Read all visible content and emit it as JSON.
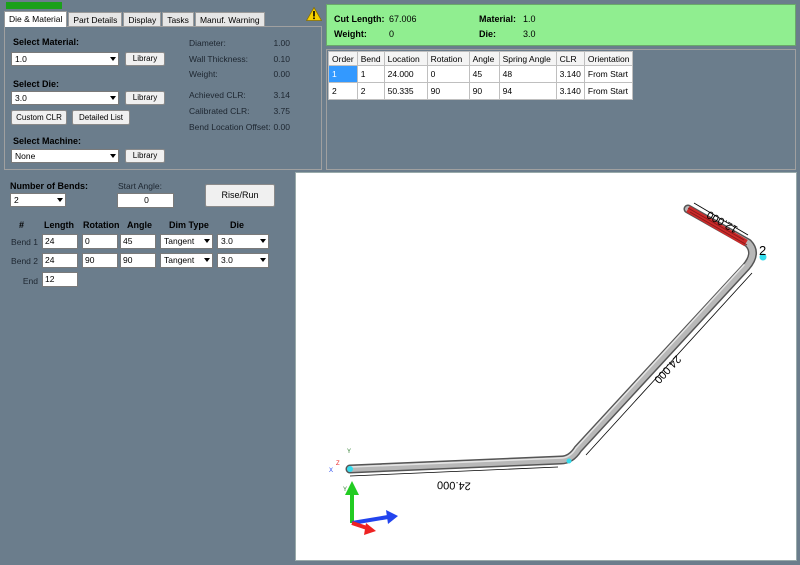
{
  "tabs": [
    "Die & Material",
    "Part Details",
    "Display",
    "Tasks",
    "Manuf. Warning"
  ],
  "die_material": {
    "select_material_label": "Select Material:",
    "material_value": "1.0",
    "select_die_label": "Select Die:",
    "die_value": "3.0",
    "select_machine_label": "Select Machine:",
    "machine_value": "None",
    "library_label": "Library",
    "custom_clr_label": "Custom CLR",
    "detailed_list_label": "Detailed List",
    "props": [
      {
        "label": "Diameter:",
        "value": "1.00"
      },
      {
        "label": "Wall Thickness:",
        "value": "0.10"
      },
      {
        "label": "Weight:",
        "value": "0.00"
      },
      {
        "label": "Achieved CLR:",
        "value": "3.14"
      },
      {
        "label": "Calibrated CLR:",
        "value": "3.75"
      },
      {
        "label": "Bend Location Offset:",
        "value": "0.00"
      }
    ]
  },
  "summary": {
    "cut_length_label": "Cut Length:",
    "cut_length": "67.006",
    "weight_label": "Weight:",
    "weight": "0",
    "material_label": "Material:",
    "material": "1.0",
    "die_label": "Die:",
    "die": "3.0"
  },
  "bend_table": {
    "columns": [
      "Order",
      "Bend",
      "Location",
      "Rotation",
      "Angle",
      "Spring Angle",
      "CLR",
      "Orientation"
    ],
    "rows": [
      [
        "1",
        "1",
        "24.000",
        "0",
        "45",
        "48",
        "3.140",
        "From Start"
      ],
      [
        "2",
        "2",
        "50.335",
        "90",
        "90",
        "94",
        "3.140",
        "From Start"
      ]
    ]
  },
  "editor": {
    "num_bends_label": "Number of Bends:",
    "num_bends": "2",
    "start_angle_label": "Start Angle:",
    "start_angle": "0",
    "rise_run_label": "Rise/Run",
    "columns": [
      "#",
      "Length",
      "Rotation",
      "Angle",
      "Dim Type",
      "Die"
    ],
    "rows": [
      {
        "label": "Bend 1",
        "length": "24",
        "rotation": "0",
        "angle": "45",
        "dim_type": "Tangent",
        "die": "3.0"
      },
      {
        "label": "Bend 2",
        "length": "24",
        "rotation": "90",
        "angle": "90",
        "dim_type": "Tangent",
        "die": "3.0"
      }
    ],
    "end_label": "End",
    "end_length": "12"
  },
  "viewport": {
    "dim1": "24.000",
    "dim2": "24.000",
    "dim3": "12.000",
    "end_marker": "2",
    "axis_y": "Y",
    "axis_x": "X",
    "axis_z": "Z"
  }
}
